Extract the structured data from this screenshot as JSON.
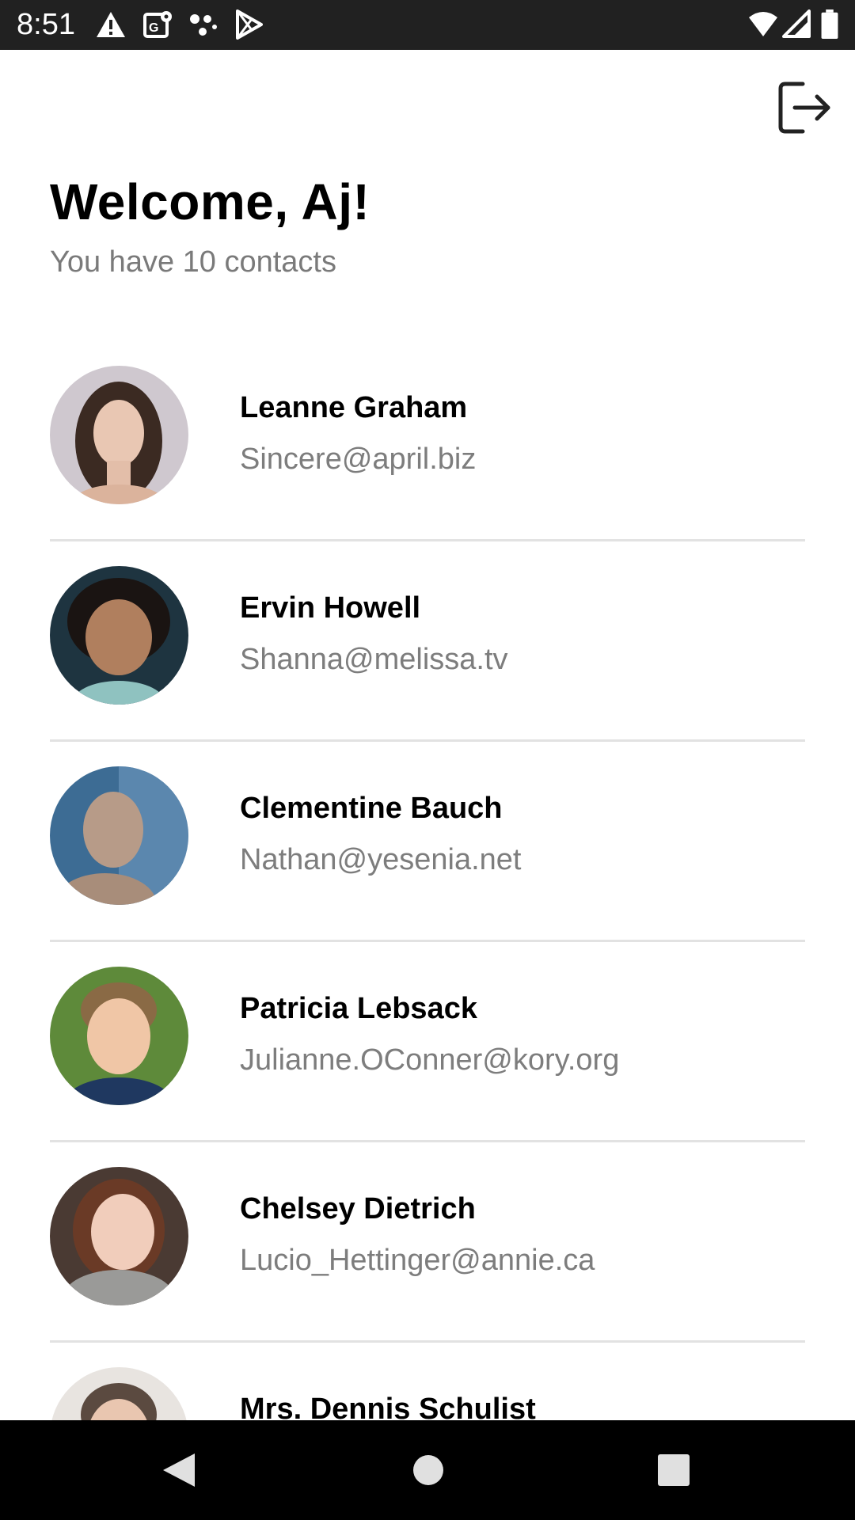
{
  "status_bar": {
    "time": "8:51",
    "left_icons": [
      "warning-icon",
      "gps-icon",
      "dots-icon",
      "play-store-icon"
    ],
    "right_icons": [
      "wifi-icon",
      "signal-icon",
      "battery-icon"
    ]
  },
  "header": {
    "welcome": "Welcome, Aj!",
    "subtitle": "You have 10 contacts",
    "logout_icon": "logout-icon"
  },
  "contacts": [
    {
      "name": "Leanne Graham",
      "email": "Sincere@april.biz",
      "avatar_bg": "#cfc8cf"
    },
    {
      "name": "Ervin Howell",
      "email": "Shanna@melissa.tv",
      "avatar_bg": "#1e3440"
    },
    {
      "name": "Clementine Bauch",
      "email": "Nathan@yesenia.net",
      "avatar_bg": "#3d6c94"
    },
    {
      "name": "Patricia Lebsack",
      "email": "Julianne.OConner@kory.org",
      "avatar_bg": "#5e8a3a"
    },
    {
      "name": "Chelsey Dietrich",
      "email": "Lucio_Hettinger@annie.ca",
      "avatar_bg": "#4a3a33"
    },
    {
      "name": "Mrs. Dennis Schulist",
      "email": "",
      "avatar_bg": "#e8e4e0"
    }
  ],
  "nav": {
    "back_icon": "back-icon",
    "home_icon": "home-icon",
    "recents_icon": "recents-icon"
  },
  "colors": {
    "status_bar": "#212121",
    "nav_bar": "#000000",
    "subtitle": "#7a7a7a",
    "divider": "#e2e2e2"
  }
}
